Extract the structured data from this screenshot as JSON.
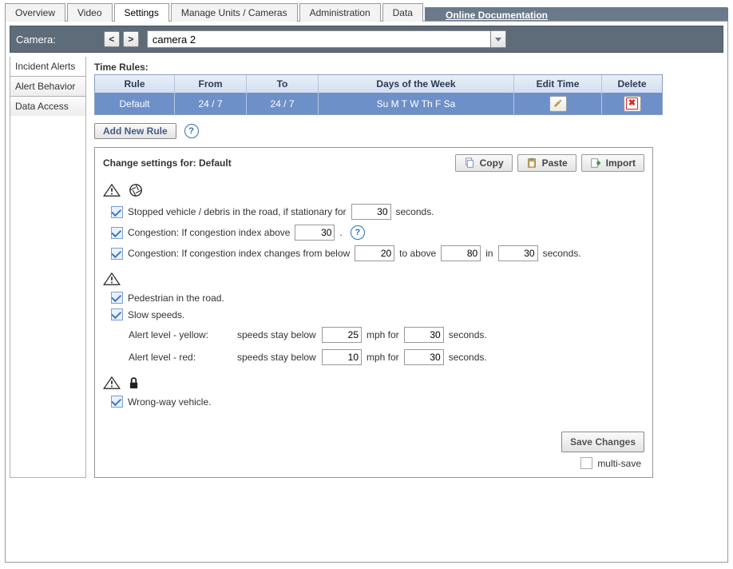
{
  "tabs": {
    "items": [
      "Overview",
      "Video",
      "Settings",
      "Manage Units / Cameras",
      "Administration",
      "Data"
    ],
    "active_index": 2,
    "doc_link": "Online Documentation"
  },
  "camera_bar": {
    "label": "Camera:",
    "prev": "<",
    "next": ">",
    "selected": "camera 2"
  },
  "sidebar": {
    "items": [
      "Incident Alerts",
      "Alert Behavior",
      "Data Access"
    ],
    "active_index": 0
  },
  "time_rules": {
    "title": "Time Rules:",
    "headers": {
      "rule": "Rule",
      "from": "From",
      "to": "To",
      "days": "Days of the Week",
      "edit": "Edit Time",
      "del": "Delete"
    },
    "rows": [
      {
        "rule": "Default",
        "from": "24 / 7",
        "to": "24 / 7",
        "days": "Su M T W Th F Sa"
      }
    ],
    "add_btn": "Add New Rule"
  },
  "panel": {
    "title_prefix": "Change settings for: ",
    "title_rule": "Default",
    "buttons": {
      "copy": "Copy",
      "paste": "Paste",
      "import": "Import"
    },
    "stopped": {
      "checked": true,
      "text_a": "Stopped vehicle / debris in the road, if stationary for",
      "value": "30",
      "text_b": "seconds."
    },
    "cong_index": {
      "checked": true,
      "text_a": "Congestion: If congestion index above",
      "value": "30",
      "text_b": "."
    },
    "cong_change": {
      "checked": true,
      "text_a": "Congestion: If congestion index changes from below",
      "below": "20",
      "text_b": "to above",
      "above": "80",
      "text_c": "in",
      "secs": "30",
      "text_d": "seconds."
    },
    "pedestrian": {
      "checked": true,
      "label": "Pedestrian in the road."
    },
    "slow": {
      "checked": true,
      "label": "Slow speeds."
    },
    "yellow": {
      "label": "Alert level - yellow:",
      "prefix": "speeds stay below",
      "speed": "25",
      "mphfor": "mph for",
      "secs": "30",
      "suffix": "seconds."
    },
    "red": {
      "label": "Alert level - red:",
      "prefix": "speeds stay below",
      "speed": "10",
      "mphfor": "mph for",
      "secs": "30",
      "suffix": "seconds."
    },
    "wrongway": {
      "checked": true,
      "label": "Wrong-way vehicle."
    },
    "save_btn": "Save Changes",
    "multi_save": {
      "checked": false,
      "label": "multi-save"
    }
  }
}
